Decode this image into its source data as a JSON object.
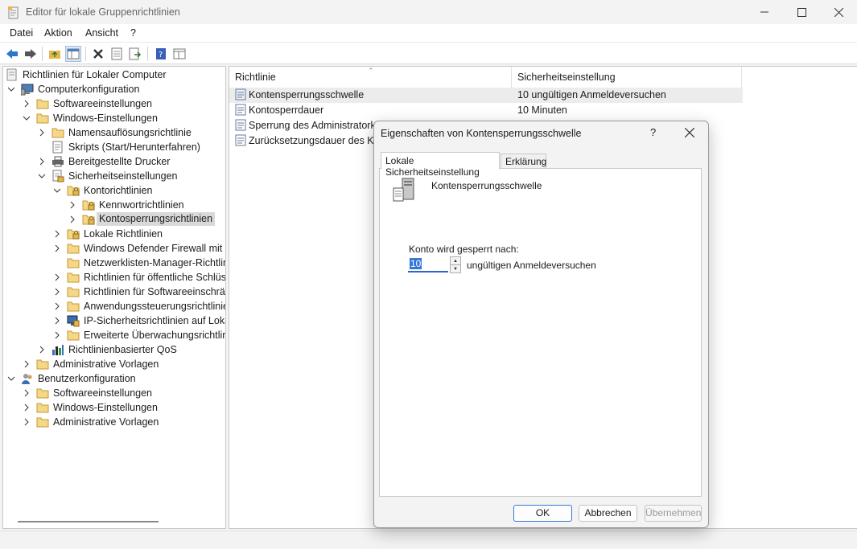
{
  "window": {
    "title": "Editor für lokale Gruppenrichtlinien"
  },
  "menu": [
    "Datei",
    "Aktion",
    "Ansicht",
    "?"
  ],
  "tree": {
    "items": [
      {
        "label": "Richtlinien für Lokaler Computer"
      },
      {
        "label": "Computerkonfiguration"
      },
      {
        "label": "Softwareeinstellungen"
      },
      {
        "label": "Windows-Einstellungen"
      },
      {
        "label": "Namensauflösungsrichtlinie"
      },
      {
        "label": "Skripts (Start/Herunterfahren)"
      },
      {
        "label": "Bereitgestellte Drucker"
      },
      {
        "label": "Sicherheitseinstellungen"
      },
      {
        "label": "Kontorichtlinien"
      },
      {
        "label": "Kennwortrichtlinien"
      },
      {
        "label": "Kontosperrungsrichtlinien"
      },
      {
        "label": "Lokale Richtlinien"
      },
      {
        "label": "Windows Defender Firewall mit erweiterter Sicherheit"
      },
      {
        "label": "Netzwerklisten-Manager-Richtlinien"
      },
      {
        "label": "Richtlinien für öffentliche Schlüssel"
      },
      {
        "label": "Richtlinien für Softwareeinschränkung"
      },
      {
        "label": "Anwendungssteuerungsrichtlinien"
      },
      {
        "label": "IP-Sicherheitsrichtlinien auf Lokaler Computer"
      },
      {
        "label": "Erweiterte Überwachungsrichtlinienkonfiguration"
      },
      {
        "label": "Richtlinienbasierter QoS"
      },
      {
        "label": "Administrative Vorlagen"
      },
      {
        "label": "Benutzerkonfiguration"
      },
      {
        "label": "Softwareeinstellungen"
      },
      {
        "label": "Windows-Einstellungen"
      },
      {
        "label": "Administrative Vorlagen"
      }
    ]
  },
  "list": {
    "col_policy": "Richtlinie",
    "col_setting": "Sicherheitseinstellung",
    "rows": [
      {
        "name": "Kontensperrungsschwelle",
        "value": "10 ungültigen Anmeldeversuchen"
      },
      {
        "name": "Kontosperrdauer",
        "value": "10 Minuten"
      },
      {
        "name": "Sperrung des Administratorkontos zulassen",
        "value": ""
      },
      {
        "name": "Zurücksetzungsdauer des Kontosperrungszählers",
        "value": ""
      }
    ]
  },
  "dialog": {
    "title": "Eigenschaften von Kontensperrungsschwelle",
    "help": "?",
    "tab_local": "Lokale Sicherheitseinstellung",
    "tab_explain": "Erklärung",
    "policy_name": "Kontensperrungsschwelle",
    "lock_label": "Konto wird gesperrt nach:",
    "threshold_value": "10",
    "threshold_suffix": "ungültigen Anmeldeversuchen",
    "ok": "OK",
    "cancel": "Abbrechen",
    "apply": "Übernehmen"
  }
}
